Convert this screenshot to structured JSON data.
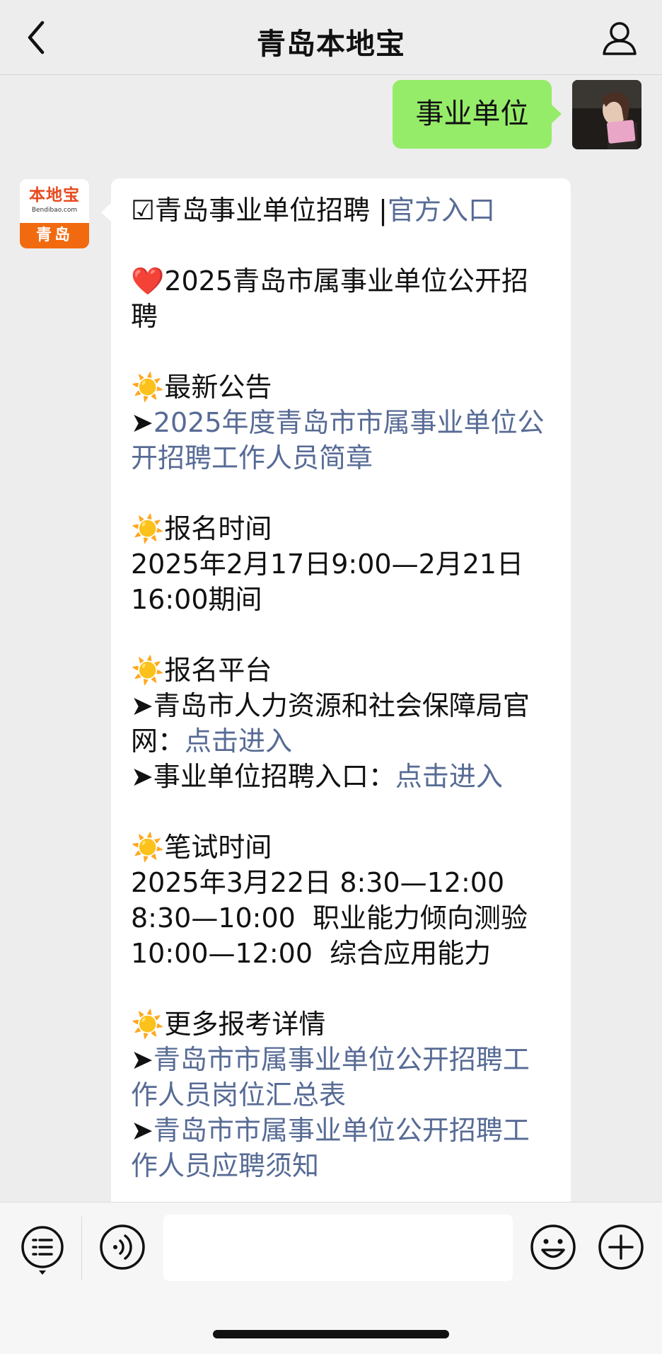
{
  "header": {
    "title": "青岛本地宝"
  },
  "icons": {
    "back": "chevron-left-icon",
    "profile": "person-icon",
    "menu": "list-menu-icon",
    "voice": "voice-icon",
    "emoji": "smile-icon",
    "more": "plus-icon"
  },
  "user_message": {
    "text": "事业单位"
  },
  "bot_avatar": {
    "logo_text": "本地宝",
    "logo_sub": "Bendibao.com",
    "city": "青岛"
  },
  "bot_message": {
    "title_prefix": "☑青岛事业单位招聘 |",
    "title_link": "官方入口",
    "heart_icon": "❤️",
    "headline": "2025青岛市属事业单位公开招聘",
    "sun_icon": "☀️",
    "arrow": "➤",
    "s1_heading": "最新公告",
    "s1_link": "2025年度青岛市市属事业单位公开招聘工作人员简章",
    "s2_heading": "报名时间",
    "s2_text": "2025年2月17日9:00—2月21日16:00期间",
    "s3_heading": "报名平台",
    "s3_item1_text": "青岛市人力资源和社会保障局官网：",
    "s3_item1_link": "点击进入",
    "s3_item2_text": "事业单位招聘入口：",
    "s3_item2_link": "点击进入",
    "s4_heading": "笔试时间",
    "s4_line1": "2025年3月22日 8:30—12:00",
    "s4_line2": "8:30—10:00  职业能力倾向测验",
    "s4_line3": "10:00—12:00  综合应用能力",
    "s5_heading": "更多报考详情",
    "s5_link1": "青岛市市属事业单位公开招聘工作人员岗位汇总表",
    "s5_link2": "青岛市市属事业单位公开招聘工作人员应聘须知"
  },
  "input": {
    "value": ""
  },
  "colors": {
    "bubble_green": "#95ec69",
    "link_blue": "#576b95",
    "background": "#ededed",
    "brand_orange": "#f26a10"
  }
}
